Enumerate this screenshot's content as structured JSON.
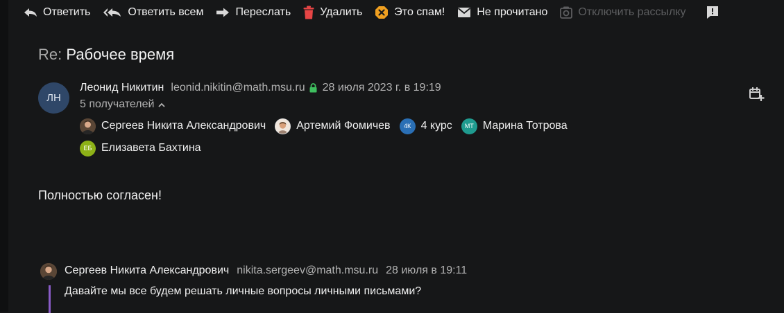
{
  "toolbar": {
    "reply": "Ответить",
    "reply_all": "Ответить всем",
    "forward": "Переслать",
    "delete": "Удалить",
    "spam": "Это спам!",
    "unread": "Не прочитано",
    "unsubscribe": "Отключить рассылку"
  },
  "message": {
    "subject_prefix": "Re:",
    "subject": "Рабочее время",
    "sender_initials": "ЛН",
    "sender_name": "Леонид Никитин",
    "sender_email": "leonid.nikitin@math.msu.ru",
    "date": "28 июля 2023 г. в 19:19",
    "recipients_toggle": "5 получателей",
    "recipients": [
      {
        "name": "Сергеев Никита Александрович",
        "avatar": "photo"
      },
      {
        "name": "Артемий Фомичев",
        "avatar": "photo"
      },
      {
        "name": "4 курс",
        "initials": "4К",
        "color": "#2a6fb5"
      },
      {
        "name": "Марина Тотрова",
        "initials": "МТ",
        "color": "#1f9b8f"
      },
      {
        "name": "Елизавета Бахтина",
        "initials": "ЕБ",
        "color": "#8db117"
      }
    ],
    "body": "Полностью согласен!"
  },
  "quoted": {
    "name": "Сергеев Никита Александрович",
    "email": "nikita.sergeev@math.msu.ru",
    "date": "28 июля в 19:11",
    "text": "Давайте мы все будем решать личные вопросы личными письмами?"
  },
  "colors": {
    "background": "#161718",
    "sender_avatar": "#2f4768",
    "lock": "#3fbf5f",
    "delete_icon": "#e64545",
    "spam_icon": "#f0a020",
    "quote_bar": "#8a5cc8"
  },
  "icons": {
    "reply": "reply-arrow-icon",
    "reply_all": "reply-all-icon",
    "forward": "forward-arrow-icon",
    "delete": "trash-icon",
    "spam": "spam-icon",
    "unread": "envelope-icon",
    "unsubscribe": "unsubscribe-icon",
    "lock": "lock-icon",
    "calendar": "calendar-add-icon"
  }
}
